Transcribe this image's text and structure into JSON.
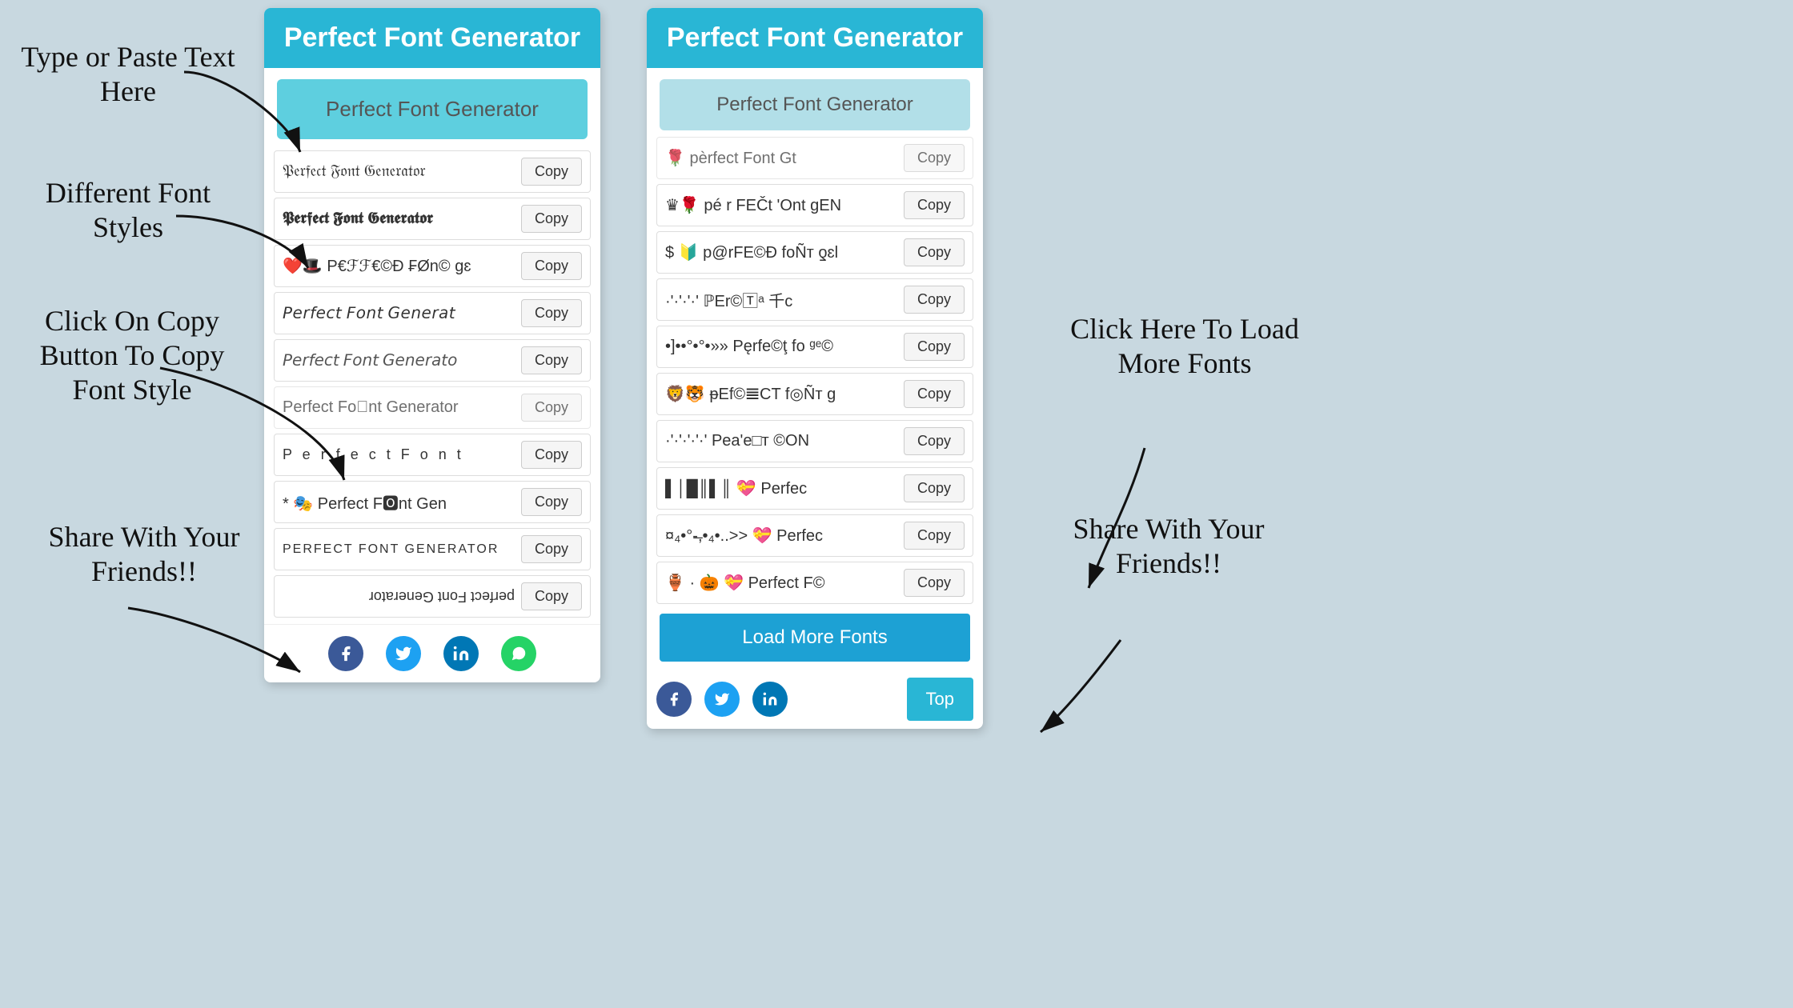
{
  "app": {
    "title": "Perfect Font Generator",
    "input_placeholder": "Perfect Font Generator",
    "input_value": "Perfect Font Generator"
  },
  "annotations": {
    "type_paste": "Type or Paste Text\nHere",
    "diff_fonts": "Different Font\nStyles",
    "click_copy": "Click On Copy\nButton To Copy\nFont Style",
    "share": "Share With\nYour\nFriends!!",
    "click_load": "Click Here To\nLoad More\nFonts",
    "share2": "Share With\nYour\nFriends!!"
  },
  "panel1": {
    "header": "Perfect Font Generator",
    "input": "Perfect Font Generator",
    "font_rows": [
      {
        "text": "𝔓𝔢𝔯𝔣𝔢𝔠𝔱 𝔉𝔬𝔫𝔱 𝔊𝔢𝔫𝔢𝔯𝔞𝔱𝔬𝔯",
        "style": "font-style-1",
        "copy": "Copy"
      },
      {
        "text": "𝕻𝖊𝖗𝖋𝖊𝖈𝖙 𝕱𝖔𝖓𝖙 𝕲𝖊𝖓𝖊𝖗𝖆𝖙𝖔𝖗",
        "style": "font-style-2",
        "copy": "Copy"
      },
      {
        "text": "❤️🎩 P€ℱℱ€©Ð ₣Øn© gɛ",
        "style": "",
        "copy": "Copy"
      },
      {
        "text": "𝘗𝘦𝘳𝘧𝘦𝘤𝘵 𝘍𝘰𝘯𝘵 𝘎𝘦𝘯𝘦𝘳𝘢𝘵",
        "style": "font-style-3",
        "copy": "Copy"
      },
      {
        "text": "𝘗𝘦𝘳𝘧𝘦𝘤𝘵 𝘍𝘰𝘯𝘵 𝘎𝘦𝘯𝘦𝘳𝘢𝘵𝘰",
        "style": "font-style-4",
        "copy": "Copy"
      },
      {
        "text": "Perfect Fo⃣nt Generator",
        "style": "",
        "copy": "Copy",
        "partial": true
      },
      {
        "text": "P e r f e c t  F o n t",
        "style": "font-style-5",
        "copy": "Copy"
      },
      {
        "text": "* 🎭 Perfect F🅾nt Gen",
        "style": "font-style-6",
        "copy": "Copy"
      },
      {
        "text": "PERFECT FONT GENERATOR",
        "style": "font-style-8",
        "copy": "Copy"
      },
      {
        "text": "ɹoʇɐɹǝuǝ⅁ ʇuoℲ ʇɔǝɟɹǝd",
        "style": "font-style-rev",
        "copy": "Copy"
      }
    ],
    "social": {
      "facebook": "f",
      "twitter": "t",
      "linkedin": "in",
      "whatsapp": "w"
    }
  },
  "panel2": {
    "header": "Perfect Font Generator",
    "input": "Perfect Font Generator",
    "font_rows": [
      {
        "text": "♛🌹 pé r FEČt 'Ont gEN",
        "style": "",
        "copy": "Copy"
      },
      {
        "text": "$ 🔰 p@rFE©Ð foÑт ƍɛl",
        "style": "",
        "copy": "Copy"
      },
      {
        "text": "·'·'·'·' ℙEr©🅃ᵃ 千c",
        "style": "",
        "copy": "Copy"
      },
      {
        "text": "•]••°•°•»» Pęrfe©ţ fo ᵍᵉ©",
        "style": "",
        "copy": "Copy"
      },
      {
        "text": "🦁🐯 ᵽEf©𝌆CT f◎Ñт g",
        "style": "",
        "copy": "Copy"
      },
      {
        "text": "·'·'·'·'·' Pea'e□т ©ON",
        "style": "",
        "copy": "Copy"
      },
      {
        "text": "▌│█║▌║ 💝 Perfec",
        "style": "",
        "copy": "Copy"
      },
      {
        "text": "¤₄•°-̶,•₄•..>>  💝 Perfec",
        "style": "",
        "copy": "Copy"
      },
      {
        "text": "🏺 · 🎃 💝 Perfect F©",
        "style": "",
        "copy": "Copy"
      }
    ],
    "load_more": "Load More Fonts",
    "top_btn": "Top",
    "social": {
      "facebook": "f",
      "twitter": "t",
      "linkedin": "in"
    }
  },
  "buttons": {
    "copy": "Copy",
    "load_more": "Load More Fonts",
    "top": "Top"
  }
}
